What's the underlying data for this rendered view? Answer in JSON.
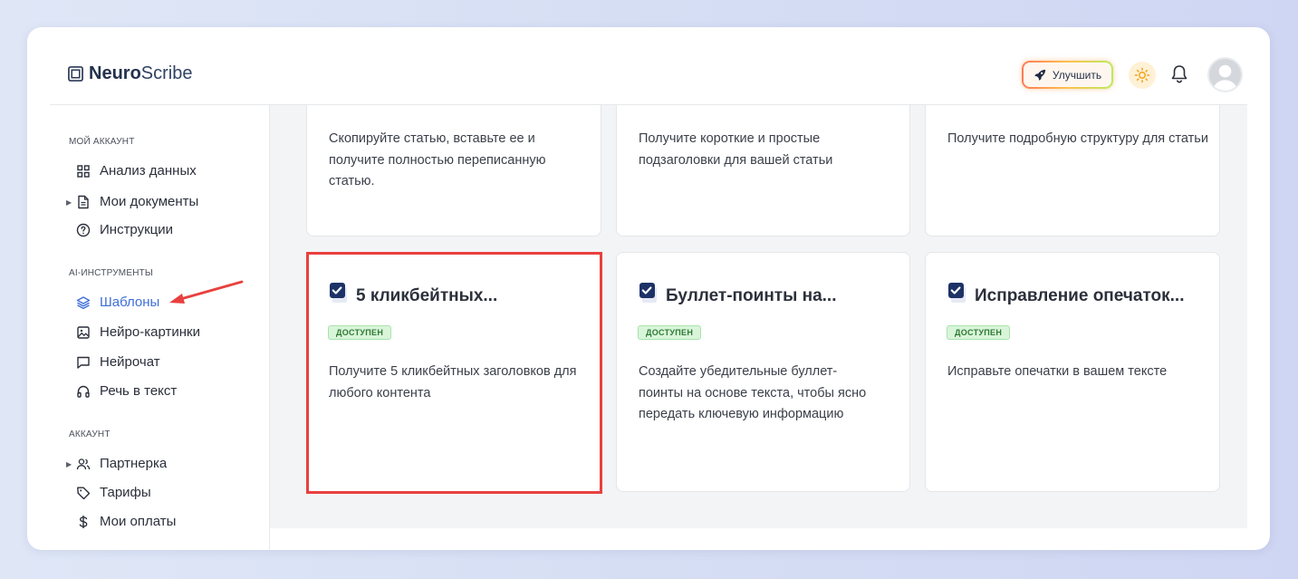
{
  "app": {
    "brand_bold": "Neuro",
    "brand_regular": "Scribe",
    "upgrade_label": "Улучшить"
  },
  "colors": {
    "accent": "#3f6fd8",
    "badge_bg": "#d8f5d9",
    "badge_text": "#2f7a34",
    "highlight": "#e8403f"
  },
  "sidebar": {
    "sections": [
      {
        "title": "МОЙ АККАУНТ"
      },
      {
        "title": "AI-ИНСТРУМЕНТЫ"
      },
      {
        "title": "АККАУНТ"
      }
    ],
    "items": [
      {
        "label": "Анализ данных",
        "icon": "grid-icon"
      },
      {
        "label": "Мои документы",
        "icon": "document-icon",
        "expandable": true
      },
      {
        "label": "Инструкции",
        "icon": "help-circle-icon"
      },
      {
        "label": "Шаблоны",
        "icon": "layers-icon",
        "active": true
      },
      {
        "label": "Нейро-картинки",
        "icon": "image-icon"
      },
      {
        "label": "Нейрочат",
        "icon": "chat-icon"
      },
      {
        "label": "Речь в текст",
        "icon": "headphones-icon"
      },
      {
        "label": "Партнерка",
        "icon": "users-icon",
        "expandable": true
      },
      {
        "label": "Тарифы",
        "icon": "tag-icon"
      },
      {
        "label": "Мои оплаты",
        "icon": "dollar-icon"
      }
    ]
  },
  "cards_top": [
    {
      "description": "Скопируйте статью, вставьте ее и получите полностью переписанную статью."
    },
    {
      "description": "Получите короткие и простые подзаголовки для вашей статьи"
    },
    {
      "description": "Получите подробную структуру для статьи"
    }
  ],
  "cards": [
    {
      "title": "5 кликбейтных...",
      "badge": "ДОСТУПЕН",
      "description": "Получите 5 кликбейтных заголовков для любого контента"
    },
    {
      "title": "Буллет-поинты на...",
      "badge": "ДОСТУПЕН",
      "description": "Создайте убедительные буллет-поинты на основе текста, чтобы ясно передать ключевую информацию"
    },
    {
      "title": "Исправление опечаток...",
      "badge": "ДОСТУПЕН",
      "description": "Исправьте опечатки в вашем тексте"
    }
  ]
}
